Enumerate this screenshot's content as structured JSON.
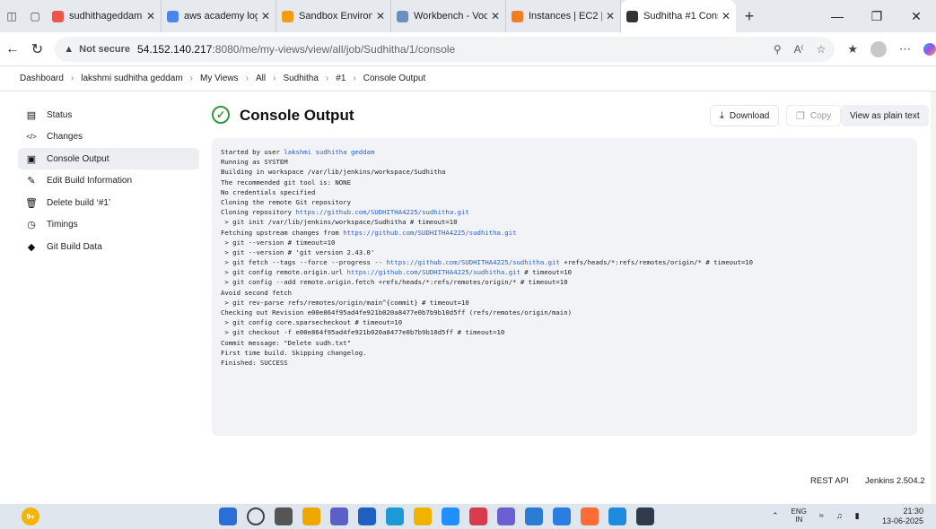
{
  "browser": {
    "tabs": [
      {
        "title": "sudhithageddam@",
        "favicon_color": "#e8574a"
      },
      {
        "title": "aws academy login",
        "favicon_color": "#4a86e8"
      },
      {
        "title": "Sandbox Environme",
        "favicon_color": "#f39c12"
      },
      {
        "title": "Workbench - Vocar",
        "favicon_color": "#6c8ebf"
      },
      {
        "title": "Instances | EC2 | us",
        "favicon_color": "#ef7d22"
      },
      {
        "title": "Sudhitha #1 Conso",
        "favicon_color": "#333333"
      }
    ],
    "url_warning": "Not secure",
    "url_host": "54.152.140.217",
    "url_rest": ":8080/me/my-views/view/all/job/Sudhitha/1/console"
  },
  "breadcrumb": [
    "Dashboard",
    "lakshmi sudhitha geddam",
    "My Views",
    "All",
    "Sudhitha",
    "#1",
    "Console Output"
  ],
  "sidebar": {
    "items": [
      {
        "label": "Status",
        "icon": "document-icon"
      },
      {
        "label": "Changes",
        "icon": "code-icon"
      },
      {
        "label": "Console Output",
        "icon": "terminal-icon"
      },
      {
        "label": "Edit Build Information",
        "icon": "edit-icon"
      },
      {
        "label": "Delete build ‘#1’",
        "icon": "trash-icon"
      },
      {
        "label": "Timings",
        "icon": "clock-icon"
      },
      {
        "label": "Git Build Data",
        "icon": "git-icon"
      }
    ]
  },
  "main": {
    "title": "Console Output",
    "download_label": "Download",
    "copy_label": "Copy",
    "plain_text_label": "View as plain text"
  },
  "console": {
    "lines": [
      {
        "pre": "Started by user ",
        "link": "lakshmi sudhitha geddam",
        "post": ""
      },
      {
        "pre": "Running as SYSTEM",
        "link": "",
        "post": ""
      },
      {
        "pre": "Building in workspace /var/lib/jenkins/workspace/Sudhitha",
        "link": "",
        "post": ""
      },
      {
        "pre": "The recommended git tool is: NONE",
        "link": "",
        "post": ""
      },
      {
        "pre": "No credentials specified",
        "link": "",
        "post": ""
      },
      {
        "pre": "Cloning the remote Git repository",
        "link": "",
        "post": ""
      },
      {
        "pre": "Cloning repository ",
        "link": "https://github.com/SUDHITHA4225/sudhitha.git",
        "post": ""
      },
      {
        "pre": " > git init /var/lib/jenkins/workspace/Sudhitha # timeout=10",
        "link": "",
        "post": ""
      },
      {
        "pre": "Fetching upstream changes from ",
        "link": "https://github.com/SUDHITHA4225/sudhitha.git",
        "post": ""
      },
      {
        "pre": " > git --version # timeout=10",
        "link": "",
        "post": ""
      },
      {
        "pre": " > git --version # 'git version 2.43.0'",
        "link": "",
        "post": ""
      },
      {
        "pre": " > git fetch --tags --force --progress -- ",
        "link": "https://github.com/SUDHITHA4225/sudhitha.git",
        "post": " +refs/heads/*:refs/remotes/origin/* # timeout=10"
      },
      {
        "pre": " > git config remote.origin.url ",
        "link": "https://github.com/SUDHITHA4225/sudhitha.git",
        "post": " # timeout=10"
      },
      {
        "pre": " > git config --add remote.origin.fetch +refs/heads/*:refs/remotes/origin/* # timeout=10",
        "link": "",
        "post": ""
      },
      {
        "pre": "Avoid second fetch",
        "link": "",
        "post": ""
      },
      {
        "pre": " > git rev-parse refs/remotes/origin/main^{commit} # timeout=10",
        "link": "",
        "post": ""
      },
      {
        "pre": "Checking out Revision e00e864f95ad4fe921b020a8477e0b7b9b10d5ff (refs/remotes/origin/main)",
        "link": "",
        "post": ""
      },
      {
        "pre": " > git config core.sparsecheckout # timeout=10",
        "link": "",
        "post": ""
      },
      {
        "pre": " > git checkout -f e00e864f95ad4fe921b020a8477e0b7b9b10d5ff # timeout=10",
        "link": "",
        "post": ""
      },
      {
        "pre": "Commit message: \"Delete sudh.txt\"",
        "link": "",
        "post": ""
      },
      {
        "pre": "First time build. Skipping changelog.",
        "link": "",
        "post": ""
      },
      {
        "pre": "Finished: SUCCESS",
        "link": "",
        "post": ""
      }
    ]
  },
  "footer": {
    "rest_api": "REST API",
    "version": "Jenkins 2.504.2"
  },
  "taskbar": {
    "weather_badge": "9+",
    "lang_top": "ENG",
    "lang_bottom": "IN",
    "time": "21:30",
    "date": "13-06-2025",
    "app_colors": [
      "#2b6fd6",
      "#444444",
      "#555555",
      "#f0a800",
      "#5b5fc7",
      "#1f5fc2",
      "#1c9ad6",
      "#f0b400",
      "#1e90ff",
      "#d83b4b",
      "#6b5fd1",
      "#2b7cd3",
      "#2a7de1",
      "#ff6b35",
      "#1f8ae0",
      "#2f3b4a"
    ]
  }
}
